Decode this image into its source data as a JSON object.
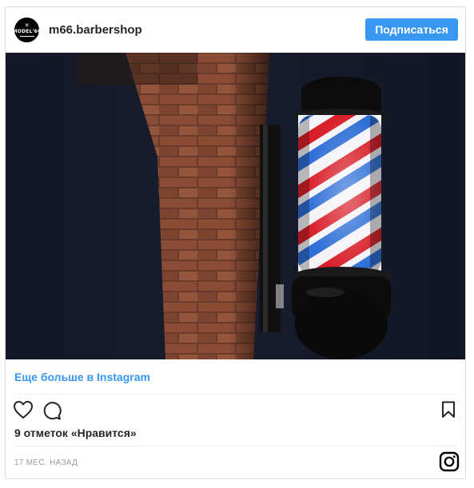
{
  "post": {
    "username": "m66.barbershop",
    "avatar_text": "MODEL'66",
    "follow_label": "Подписаться",
    "more_link": "Еще больше в Instagram",
    "likes": "9 отметок «Нравится»",
    "timestamp": "17 МЕС. НАЗАД"
  },
  "icons": {
    "like": "heart-icon",
    "comment": "comment-icon",
    "save": "bookmark-icon",
    "brand": "instagram-icon"
  },
  "colors": {
    "accent": "#3897f0",
    "text": "#262626",
    "muted": "#999999",
    "border": "#dbdbdb"
  }
}
